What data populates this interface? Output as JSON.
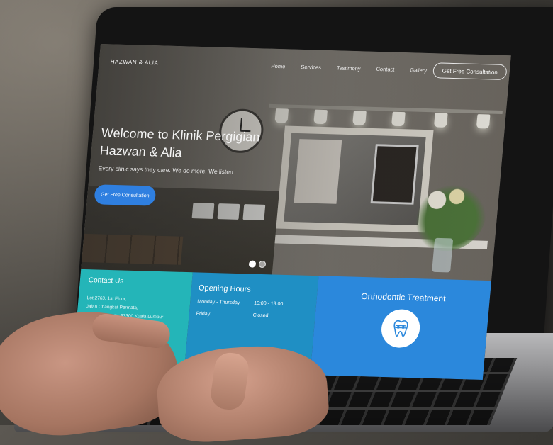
{
  "nav": {
    "brand": "HAZWAN & ALIA",
    "links": [
      "Home",
      "Services",
      "Testimony",
      "Contact",
      "Gallery"
    ],
    "cta": "Get Free Consultation"
  },
  "hero": {
    "title_line1": "Welcome to Klinik Pergigian",
    "title_line2": "Hazwan & Alia",
    "subtitle": "Every clinic says they care. We do more. We listen",
    "button": "Get Free Consultation",
    "slides": 2,
    "active_slide": 1
  },
  "contact": {
    "title": "Contact Us",
    "address_lines": [
      "Lot 2763, 1st Floor,",
      "Jalan Changkat Permata,",
      "Taman Permata, 53300 Kuala Lumpur"
    ]
  },
  "hours": {
    "title": "Opening Hours",
    "rows": [
      {
        "day": "Monday - Thursday",
        "time": "10:00 - 18:00"
      },
      {
        "day": "Friday",
        "time": "Closed"
      }
    ]
  },
  "service": {
    "title": "Orthodontic Treatment",
    "icon": "tooth-braces-icon"
  },
  "colors": {
    "accent_blue": "#2f7fe0",
    "contact_teal": "#24b5b8",
    "hours_blue": "#1f8fc4",
    "service_blue": "#2b88dc"
  }
}
